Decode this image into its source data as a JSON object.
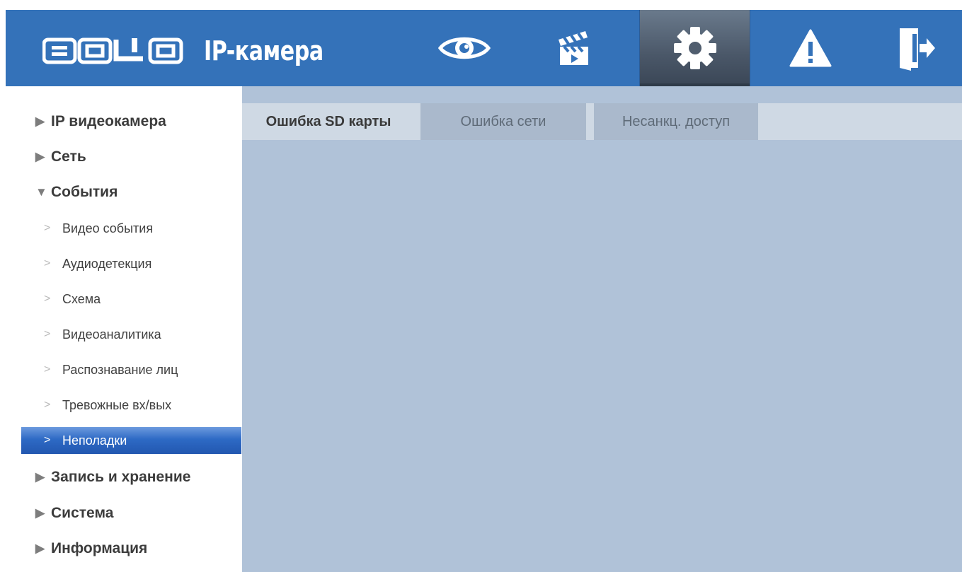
{
  "header": {
    "logo_letters": [
      "B",
      "O",
      "L",
      "I",
      "D"
    ],
    "logo_text": "BOLID",
    "app_title": "IP-камера",
    "bg_color": "#3472b9",
    "nav": [
      {
        "icon": "eye-icon",
        "label": "Просмотр"
      },
      {
        "icon": "clapperboard-icon",
        "label": "Воспроизведение"
      },
      {
        "icon": "gear-icon",
        "label": "Настройки",
        "active": true
      },
      {
        "icon": "alarm-warning-icon",
        "label": "Тревога"
      },
      {
        "icon": "logout-icon",
        "label": "Выход"
      }
    ]
  },
  "sidebar": {
    "items": [
      {
        "label": "IP видеокамера",
        "level": 1,
        "expanded": false
      },
      {
        "label": "Сеть",
        "level": 1,
        "expanded": false
      },
      {
        "label": "События",
        "level": 1,
        "expanded": true
      },
      {
        "label": "Видео события",
        "level": 2
      },
      {
        "label": "Аудиодетекция",
        "level": 2
      },
      {
        "label": "Схема",
        "level": 2
      },
      {
        "label": "Видеоаналитика",
        "level": 2
      },
      {
        "label": "Распознавание лиц",
        "level": 2
      },
      {
        "label": "Тревожные вх/вых",
        "level": 2
      },
      {
        "label": "Неполадки",
        "level": 2,
        "active": true
      },
      {
        "label": "Запись и хранение",
        "level": 1,
        "expanded": false
      },
      {
        "label": "Система",
        "level": 1,
        "expanded": false
      },
      {
        "label": "Информация",
        "level": 1,
        "expanded": false
      }
    ],
    "active_color": "#2e6ac5"
  },
  "content": {
    "tabs": [
      {
        "label": "Ошибка SD карты",
        "active": true
      },
      {
        "label": "Ошибка сети",
        "active": false
      },
      {
        "label": "Несанкц. доступ",
        "active": false
      }
    ],
    "bg_color": "#b0c2d8"
  }
}
